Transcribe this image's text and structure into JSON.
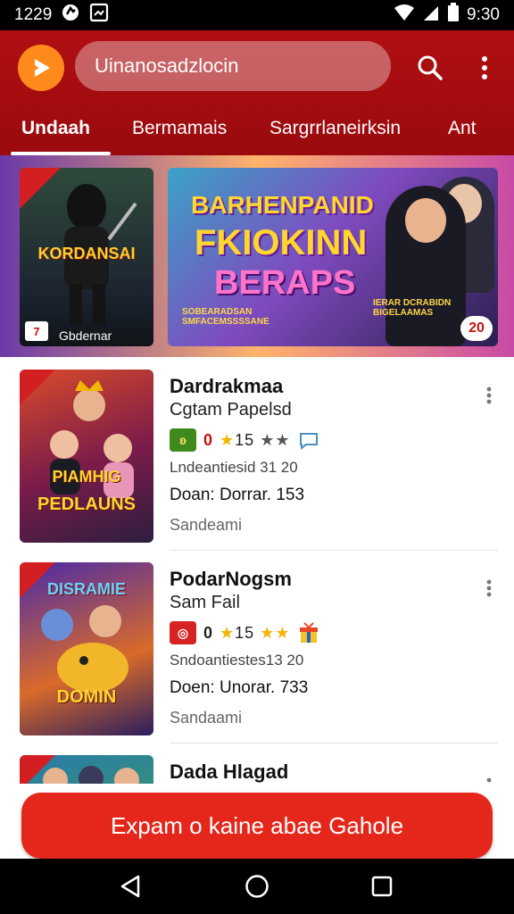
{
  "status_bar": {
    "time_left": "1229",
    "time_right": "9:30"
  },
  "app_bar": {
    "search_text": "Uinanosadzlocin",
    "tabs": [
      {
        "label": "Undaah",
        "active": true
      },
      {
        "label": "Bermamais",
        "active": false
      },
      {
        "label": "Sargrrlaneirksin",
        "active": false
      },
      {
        "label": "Ant",
        "active": false
      }
    ],
    "colors": {
      "accent": "#b00f12",
      "logo": "#ff8a1c"
    }
  },
  "banners": {
    "small": {
      "title": "KORDANSAI",
      "sub": "Gbdernar",
      "badge": "7"
    },
    "big": {
      "line1": "BARHENPANID",
      "line2": "FKIOKINN",
      "line3": "BERAPS",
      "foot_left": "SOBEARADSAN SMFACEMSSSSANE",
      "foot_right": "IERAR DCRABIDN BIGELAAMAS",
      "number": "20"
    }
  },
  "apps": [
    {
      "name": "Dardrakmaa",
      "developer": "Cgtam Papelsd",
      "chip_color": "#3e8a1c",
      "chip_text": "ʚ",
      "rating_prefix": "0",
      "rating": "15",
      "size": "Lndeantiesid 31 20",
      "downloads": "Doan: Dorrar. 153",
      "category": "Sandeami",
      "thumb_label": "PEDLAUNS",
      "thumb_label2": "PIAMHIG",
      "thumb_colors": [
        "#d94a2a",
        "#7a1b4a",
        "#2c1e3e"
      ]
    },
    {
      "name": "PodarNogsm",
      "developer": "Sam Fail",
      "chip_color": "#d62222",
      "chip_text": "◎",
      "rating_prefix": "0",
      "rating": "15",
      "size": "Sndoantiestes13 20",
      "downloads": "Doen: Unorar. 733",
      "category": "Sandaami",
      "thumb_label": "DOMIN",
      "thumb_label2": "DISRAMIE",
      "thumb_colors": [
        "#4a2aa8",
        "#d96a2a",
        "#2a1e5e"
      ]
    },
    {
      "name": "Dada Hlagad",
      "developer": "",
      "chip_color": "#888",
      "chip_text": "",
      "rating_prefix": "",
      "rating": "",
      "size": "",
      "downloads": "",
      "category": "",
      "thumb_label": "",
      "thumb_label2": "",
      "thumb_colors": [
        "#2a7aa8",
        "#3a9a6a",
        "#1e2e4e"
      ]
    }
  ],
  "cta": {
    "label": "Expam o kaine abae Gahole",
    "color": "#e4271a"
  }
}
